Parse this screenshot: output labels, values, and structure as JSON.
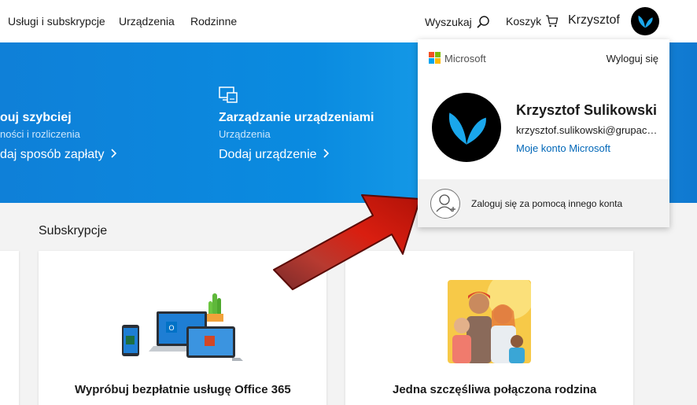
{
  "topnav": {
    "links": [
      "Usługi i subskrypcje",
      "Urządzenia",
      "Rodzinne"
    ],
    "search_label": "Wyszukaj",
    "cart_label": "Koszyk",
    "user_label": "Krzysztof"
  },
  "hero": {
    "billing": {
      "title": "ouj szybciej",
      "subtitle": "ności i rozliczenia",
      "link": "daj sposób zapłaty"
    },
    "devices": {
      "title": "Zarządzanie urządzeniami",
      "subtitle": "Urządzenia",
      "link": "Dodaj urządzenie"
    }
  },
  "subscriptions": {
    "title": "Subskrypcje",
    "cards": [
      {
        "title": "Wypróbuj bezpłatnie usługę Office 365"
      },
      {
        "title": "Jedna szczęśliwa połączona rodzina"
      }
    ]
  },
  "account_panel": {
    "brand": "Microsoft",
    "signout": "Wyloguj się",
    "name": "Krzysztof Sulikowski",
    "email": "krzysztof.sulikowski@grupacentrum.pl",
    "account_link": "Moje konto Microsoft",
    "other_account": "Zaloguj się za pomocą innego konta"
  },
  "colors": {
    "accent_blue": "#0067b8",
    "hero_blue": "#0a8be0",
    "arrow_red": "#c0180c",
    "ms_red": "#f25022",
    "ms_green": "#7fba00",
    "ms_blue": "#00a4ef",
    "ms_yellow": "#ffb900"
  },
  "icons": [
    "search-icon",
    "cart-icon",
    "devices-icon",
    "microsoft-logo",
    "add-person-icon",
    "butterfly-logo-icon",
    "chevron-right-icon"
  ]
}
